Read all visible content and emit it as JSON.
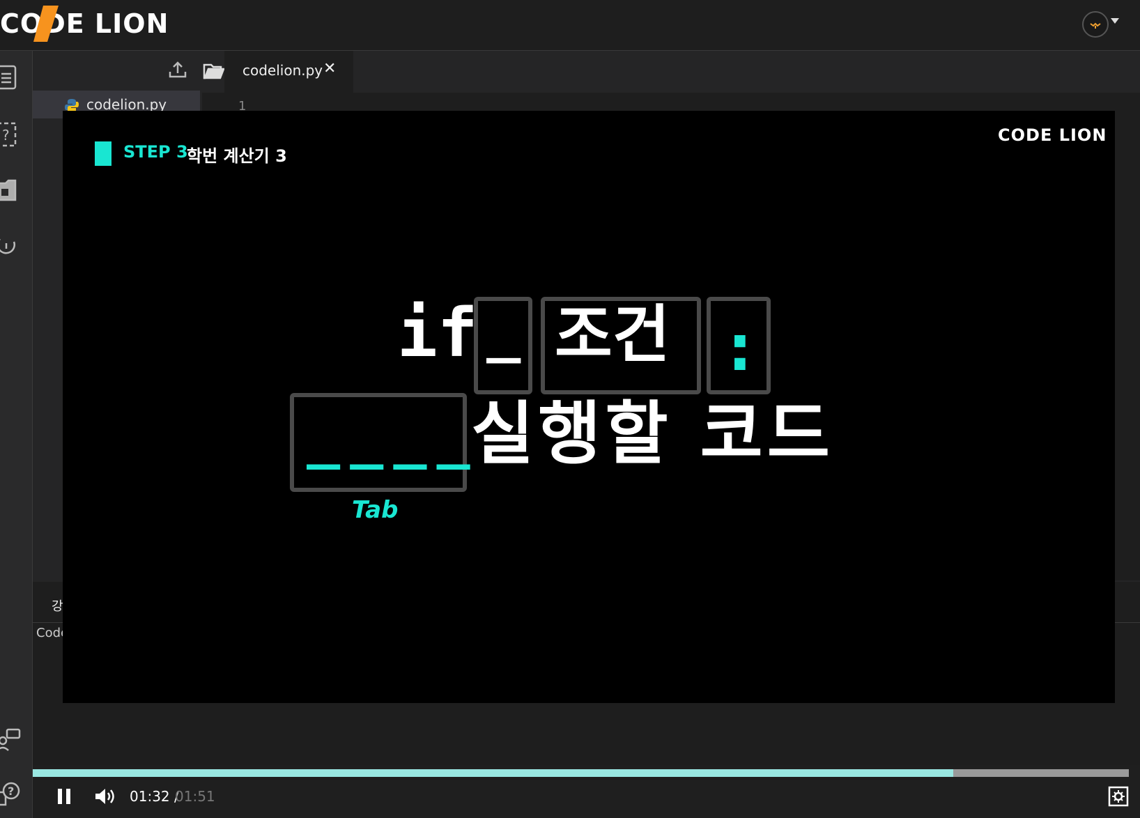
{
  "app": {
    "logo_text": "CODE LION"
  },
  "sidebar_icons": [
    "document-list-icon",
    "quiz-icon",
    "folder-icon",
    "history-icon",
    "chat-icon",
    "help-icon"
  ],
  "file_panel": {
    "files": [
      {
        "name": "codelion.py",
        "icon": "python-icon"
      }
    ]
  },
  "editor": {
    "tab_label": "codelion.py",
    "tab_close": "✕",
    "line_number": "1"
  },
  "bottom_panel": {
    "tab_fragment": "강",
    "output_fragment": "Code"
  },
  "video": {
    "step_label": "STEP 3",
    "step_title": "학번 계산기 3",
    "logo_text": "CODE LION",
    "code_keyword": "if",
    "code_space": "_",
    "code_condition": "조건",
    "code_colon": ":",
    "code_indent": "____",
    "code_body": "실행할 코드",
    "indent_hint": "Tab",
    "accent_color": "#19e6d2"
  },
  "player": {
    "current_time": "01:32",
    "separator": "/",
    "duration": "01:51",
    "progress_fraction": 0.84
  }
}
